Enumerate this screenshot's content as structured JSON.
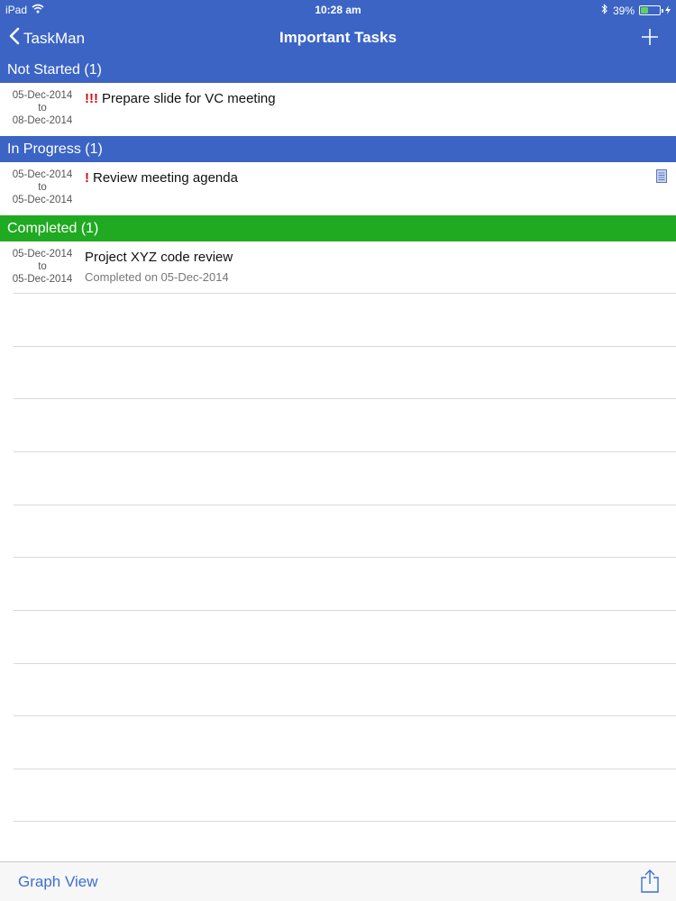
{
  "status_bar": {
    "device": "iPad",
    "time": "10:28 am",
    "battery": "39%",
    "battery_level": 0.39
  },
  "nav": {
    "back_label": "TaskMan",
    "title": "Important Tasks"
  },
  "sections": [
    {
      "header": "Not Started (1)",
      "color": "#3b64c5",
      "task": {
        "start": "05-Dec-2014",
        "to": "to",
        "end": "08-Dec-2014",
        "priority": "!!!",
        "title": "Prepare slide for VC meeting"
      }
    },
    {
      "header": "In Progress (1)",
      "color": "#3b64c5",
      "task": {
        "start": "05-Dec-2014",
        "to": "to",
        "end": "05-Dec-2014",
        "priority": "!",
        "title": "Review meeting agenda",
        "has_note": true
      }
    },
    {
      "header": "Completed (1)",
      "color": "#1faa21",
      "task": {
        "start": "05-Dec-2014",
        "to": "to",
        "end": "05-Dec-2014",
        "title": "Project XYZ code review",
        "subtitle": "Completed on 05-Dec-2014"
      }
    }
  ],
  "toolbar": {
    "graph_view": "Graph View"
  },
  "icons": {
    "back": "chevron-left-icon",
    "add": "plus-icon",
    "note": "note-icon",
    "share": "share-icon",
    "wifi": "wifi-icon",
    "bluetooth": "bluetooth-icon",
    "battery": "battery-icon"
  }
}
